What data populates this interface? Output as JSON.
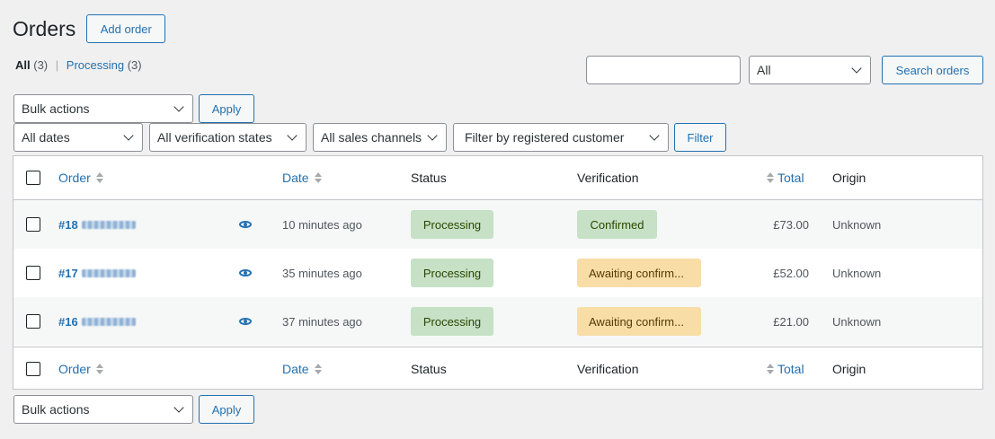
{
  "header": {
    "title": "Orders",
    "add_order_label": "Add order"
  },
  "views": {
    "all_label": "All",
    "all_count": "(3)",
    "processing_label": "Processing",
    "processing_count": "(3)",
    "separator": "|"
  },
  "search": {
    "placeholder": "",
    "status_value": "All",
    "button_label": "Search orders"
  },
  "bulk": {
    "value": "Bulk actions",
    "apply_label": "Apply"
  },
  "filters": {
    "dates": "All dates",
    "verification": "All verification states",
    "channels": "All sales channels",
    "customer": "Filter by registered customer",
    "button_label": "Filter"
  },
  "table": {
    "columns": {
      "order": "Order",
      "date": "Date",
      "status": "Status",
      "verification": "Verification",
      "total": "Total",
      "origin": "Origin"
    },
    "rows": [
      {
        "order": "#18",
        "date": "10 minutes ago",
        "status": "Processing",
        "verification": "Confirmed",
        "total": "£73.00",
        "origin": "Unknown"
      },
      {
        "order": "#17",
        "date": "35 minutes ago",
        "status": "Processing",
        "verification": "Awaiting confirm...",
        "total": "£52.00",
        "origin": "Unknown"
      },
      {
        "order": "#16",
        "date": "37 minutes ago",
        "status": "Processing",
        "verification": "Awaiting confirm...",
        "total": "£21.00",
        "origin": "Unknown"
      }
    ]
  },
  "colors": {
    "accent": "#2271b1",
    "processing_bg": "#c6e1c6",
    "awaiting_bg": "#f8dda7"
  },
  "icons": {
    "preview": "eye-icon",
    "sort": "sort-arrows-icon",
    "dropdown": "chevron-down-icon"
  }
}
